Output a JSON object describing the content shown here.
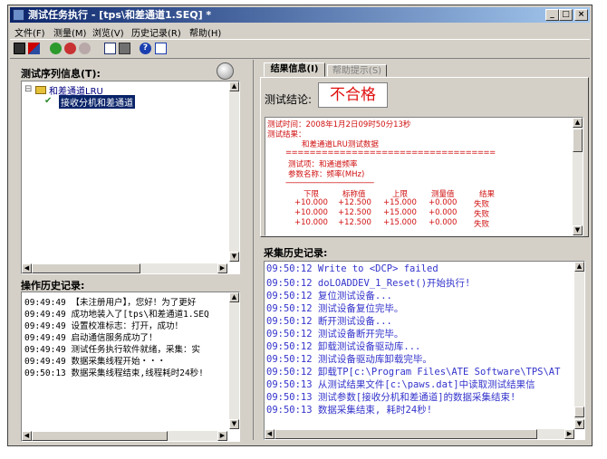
{
  "window": {
    "title": "测试任务执行 - [tps\\和差通道1.SEQ] *",
    "min": "_",
    "max": "□",
    "close": "×"
  },
  "menu": [
    "文件(F)",
    "测量(M)",
    "浏览(V)",
    "历史记录(R)",
    "帮助(H)"
  ],
  "toolbar": {
    "icons": [
      "save-icon",
      "run-icon",
      "start-icon",
      "stop-icon",
      "settings-icon",
      "report-icon",
      "print-icon",
      "help-icon",
      "about-icon"
    ]
  },
  "sequence": {
    "label": "测试序列信息(T):",
    "root": "和差通道LRU",
    "child": "接收分机和差通道"
  },
  "oplog": {
    "label": "操作历史记录:",
    "lines": [
      {
        "t": "09:49:49",
        "m": "【未注册用户】，您好！为了更好"
      },
      {
        "t": "09:49:49",
        "m": "成功地装入了[tps\\和差通道1.SEQ"
      },
      {
        "t": "09:49:49",
        "m": "设置校准标志：打开，成功！"
      },
      {
        "t": "09:49:49",
        "m": "启动通信服务成功了！"
      },
      {
        "t": "09:49:49",
        "m": "测试任务执行软件就绪，采集：实"
      },
      {
        "t": "09:49:49",
        "m": "数据采集线程开始・・・"
      },
      {
        "t": "09:50:13",
        "m": "数据采集线程结束,线程耗时24秒!"
      }
    ]
  },
  "tabs": {
    "active": "结果信息(I)",
    "inactive": "帮助提示(S)"
  },
  "verdict": {
    "label": "测试结论:",
    "value": "不合格"
  },
  "result": {
    "time": "测试时间：2008年1月2日09时50分13秒",
    "result_label": "测试结果：",
    "title": "和差通道LRU测试数据",
    "separator": "===================================",
    "item": "测试项：和通道频率",
    "param": "参数名称：频率(MHz)",
    "dash": "-----------------------------------------------",
    "headers": [
      "下限",
      "标称值",
      "上限",
      "测量值",
      "结果"
    ],
    "rows": [
      [
        "+10.000",
        "+12.500",
        "+15.000",
        "+0.000",
        "失败"
      ],
      [
        "+10.000",
        "+12.500",
        "+15.000",
        "+0.000",
        "失败"
      ],
      [
        "+10.000",
        "+12.500",
        "+15.000",
        "+0.000",
        "失败"
      ]
    ]
  },
  "history": {
    "label": "采集历史记录:",
    "lines": [
      {
        "t": "09:50:12",
        "m": "Write to <DCP> failed"
      },
      {
        "t": "09:50:12",
        "m": "doLOADDEV_1_Reset()开始执行!"
      },
      {
        "t": "09:50:12",
        "m": "复位测试设备..."
      },
      {
        "t": "09:50:12",
        "m": "测试设备复位完毕。"
      },
      {
        "t": "09:50:12",
        "m": "断开测试设备..."
      },
      {
        "t": "09:50:12",
        "m": "测试设备断开完毕。"
      },
      {
        "t": "09:50:12",
        "m": "卸载测试设备驱动库..."
      },
      {
        "t": "09:50:12",
        "m": "测试设备驱动库卸载完毕。"
      },
      {
        "t": "09:50:12",
        "m": "卸载TP[c:\\Program Files\\ATE Software\\TPS\\AT"
      },
      {
        "t": "09:50:13",
        "m": "从测试结果文件[c:\\paws.dat]中读取测试结果信"
      },
      {
        "t": "09:50:13",
        "m": "测试参数[接收分机和差通道]的数据采集结束!"
      },
      {
        "t": "09:50:13",
        "m": "数据采集结束, 耗时24秒!"
      }
    ]
  }
}
